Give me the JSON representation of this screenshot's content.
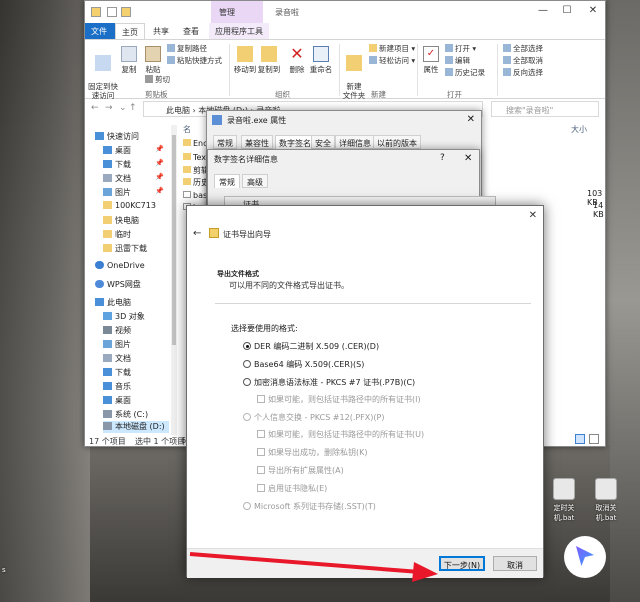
{
  "explorer": {
    "title": "录音啦",
    "context_tab_group": "管理",
    "tabs": [
      "文件",
      "主页",
      "共享",
      "查看",
      "应用程序工具"
    ],
    "ribbon": {
      "pin_quick": "固定到快\n速访问",
      "copy": "复制",
      "paste": "粘贴",
      "copy_path": "复制路径",
      "paste_shortcut": "粘贴快捷方式",
      "cut": "剪切",
      "group_clipboard": "剪贴板",
      "move_to": "移动到",
      "copy_to": "复制到",
      "delete": "删除",
      "rename": "重命名",
      "group_organize": "组织",
      "new_folder": "新建\n文件夹",
      "new_item": "新建项目",
      "easy_access": "轻松访问",
      "group_new": "新建",
      "properties": "属性",
      "open": "打开",
      "edit": "编辑",
      "history": "历史记录",
      "group_open": "打开",
      "select_all": "全部选择",
      "select_none": "全部取消",
      "invert_selection": "反向选择"
    },
    "address": [
      "此电脑",
      "本地磁盘 (D:)",
      "录音啦"
    ],
    "search_placeholder": "搜索\"录音啦\"",
    "column_name": "名",
    "column_size": "大小",
    "nav_items": [
      "快速访问",
      "桌面",
      "下载",
      "文档",
      "图片",
      "100KC713",
      "快电脑",
      "临时",
      "迅雷下载",
      "OneDrive",
      "WPS网盘",
      "此电脑",
      "3D 对象",
      "视频",
      "图片",
      "文档",
      "下载",
      "音乐",
      "桌面",
      "系统 (C:)",
      "本地磁盘 (D:)"
    ],
    "file_prefixes": [
      "Enc",
      "Tex",
      "剪辑",
      "历史",
      "bas",
      "bas"
    ],
    "sizes": [
      "103 KB",
      "14 KB"
    ],
    "status_count": "17 个项目",
    "status_selected": "选中 1 个项目",
    "status_size": "6."
  },
  "properties": {
    "title": "录音啦.exe 属性",
    "tabs": [
      "常规",
      "兼容性",
      "数字签名",
      "安全",
      "详细信息",
      "以前的版本"
    ]
  },
  "signature_details": {
    "title": "数字签名详细信息",
    "tabs": [
      "常规",
      "高级"
    ],
    "cert_label": "证书"
  },
  "wizard": {
    "title": "证书导出向导",
    "heading": "导出文件格式",
    "description": "可以用不同的文件格式导出证书。",
    "prompt": "选择要使用的格式:",
    "options": [
      {
        "label": "DER 编码二进制 X.509 (.CER)(D)",
        "selected": true,
        "enabled": true
      },
      {
        "label": "Base64 编码 X.509(.CER)(S)",
        "selected": false,
        "enabled": true
      },
      {
        "label": "加密消息语法标准 - PKCS #7 证书(.P7B)(C)",
        "selected": false,
        "enabled": true
      }
    ],
    "p7b_include_all": "如果可能，则包括证书路径中的所有证书(I)",
    "pfx_option": "个人信息交换 - PKCS #12(.PFX)(P)",
    "pfx_checks": [
      "如果可能，则包括证书路径中的所有证书(U)",
      "如果导出成功，删除私钥(K)",
      "导出所有扩展属性(A)",
      "启用证书隐私(E)"
    ],
    "sst_option": "Microsoft 系列证书存储(.SST)(T)",
    "next_button": "下一步(N)",
    "cancel_button": "取消"
  },
  "desktop": {
    "icons": [
      "定时关机.bat",
      "取消关机.bat"
    ],
    "left_label": "s"
  },
  "colors": {
    "accent": "#1c6fc7",
    "arrow": "#e8182a",
    "context_tab": "#e9d7f5"
  }
}
